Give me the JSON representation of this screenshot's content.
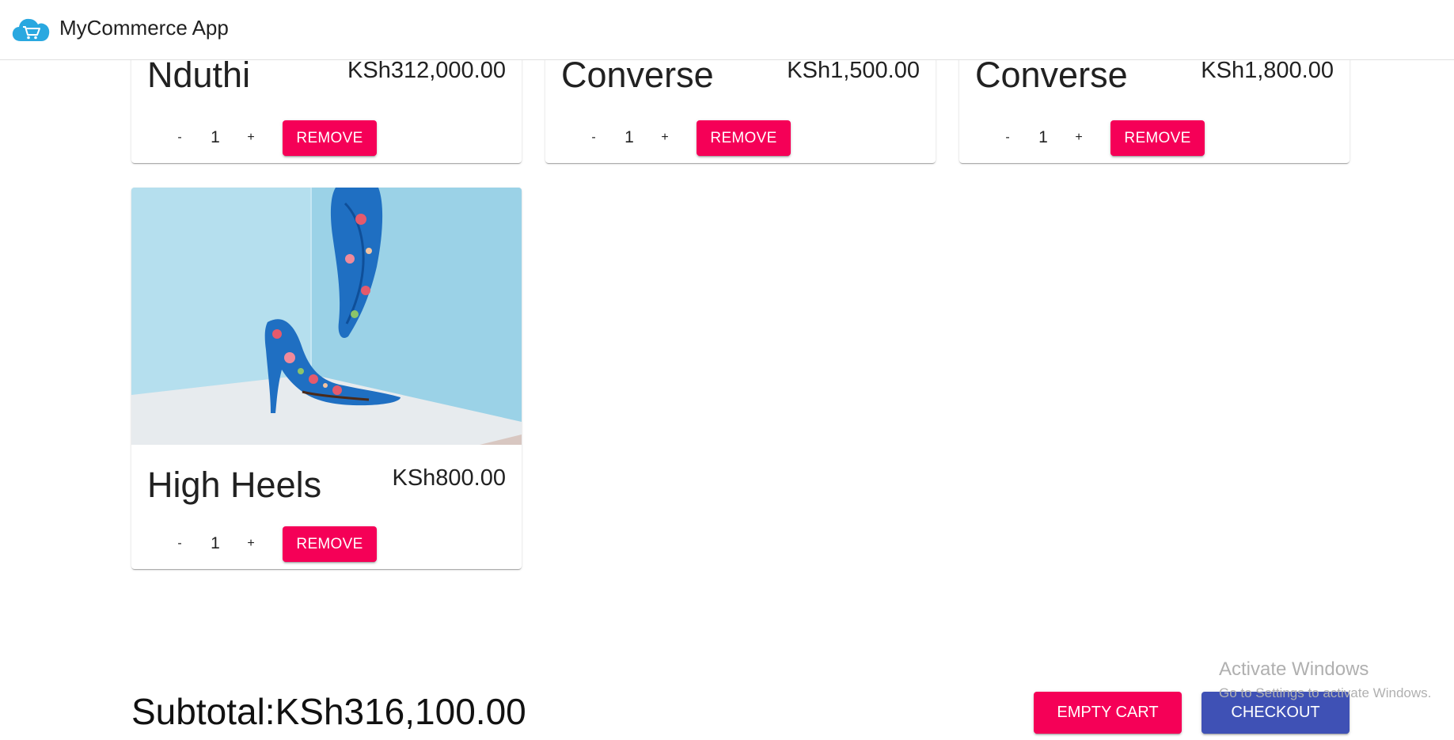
{
  "app": {
    "title": "MyCommerce App"
  },
  "colors": {
    "accent": "#f50057",
    "primary": "#3f51b5",
    "logo": "#29a8e0"
  },
  "cart_items": [
    {
      "name": "Nduthi",
      "price": "KSh312,000.00",
      "quantity": "1",
      "minus": "-",
      "plus": "+",
      "remove_label": "REMOVE"
    },
    {
      "name": "Converse",
      "price": "KSh1,500.00",
      "quantity": "1",
      "minus": "-",
      "plus": "+",
      "remove_label": "REMOVE"
    },
    {
      "name": "Converse",
      "price": "KSh1,800.00",
      "quantity": "1",
      "minus": "-",
      "plus": "+",
      "remove_label": "REMOVE"
    },
    {
      "name": "High Heels",
      "price": "KSh800.00",
      "quantity": "1",
      "minus": "-",
      "plus": "+",
      "remove_label": "REMOVE"
    }
  ],
  "footer": {
    "subtotal": "Subtotal:KSh316,100.00",
    "empty_cart_label": "EMPTY CART",
    "checkout_label": "CHECKOUT"
  },
  "watermark": {
    "title": "Activate Windows",
    "subtitle": "Go to Settings to activate Windows."
  }
}
